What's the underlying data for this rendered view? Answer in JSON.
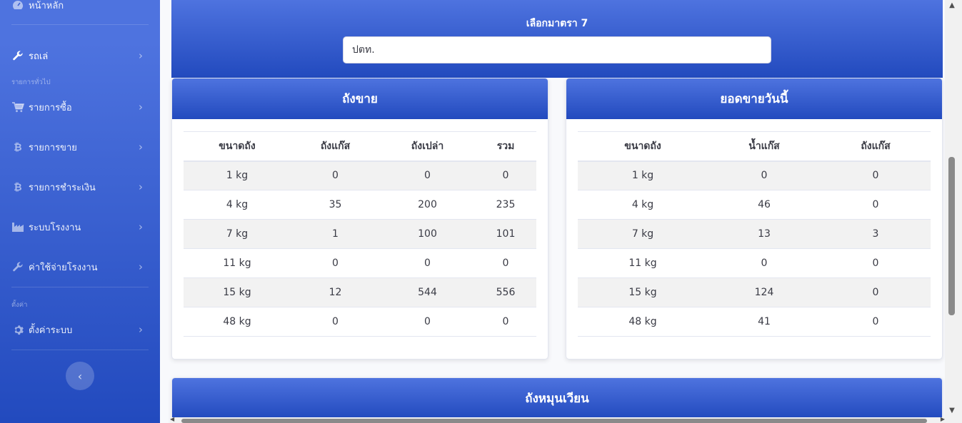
{
  "sidebar": {
    "dashboard": {
      "label": "หน้าหลัก",
      "icon": "gauge-icon"
    },
    "trucks": {
      "label": "รถเล่",
      "icon": "wrench-icon"
    },
    "heading_general": "รายการทั่วไป",
    "items": [
      {
        "label": "รายการซื้อ",
        "icon": "cart-icon"
      },
      {
        "label": "รายการขาย",
        "icon": "bitcoin-icon"
      },
      {
        "label": "รายการชำระเงิน",
        "icon": "bitcoin-icon"
      },
      {
        "label": "ระบบโรงงาน",
        "icon": "factory-icon"
      },
      {
        "label": "ค่าใช้จ่ายโรงงาน",
        "icon": "wrench-icon"
      }
    ],
    "heading_settings": "ตั้งค่า",
    "settings": {
      "label": "ตั้งค่าระบบ",
      "icon": "gear-icon"
    }
  },
  "banner": {
    "title": "เลือกมาตรา 7",
    "selected": "ปตท."
  },
  "stock_card": {
    "title": "ถังขาย",
    "headers": [
      "ขนาดถัง",
      "ถังแก๊ส",
      "ถังเปล่า",
      "รวม"
    ],
    "rows": [
      [
        "1 kg",
        "0",
        "0",
        "0"
      ],
      [
        "4 kg",
        "35",
        "200",
        "235"
      ],
      [
        "7 kg",
        "1",
        "100",
        "101"
      ],
      [
        "11 kg",
        "0",
        "0",
        "0"
      ],
      [
        "15 kg",
        "12",
        "544",
        "556"
      ],
      [
        "48 kg",
        "0",
        "0",
        "0"
      ]
    ]
  },
  "sales_card": {
    "title": "ยอดขายวันนี้",
    "headers": [
      "ขนาดถัง",
      "น้ำแก๊ส",
      "ถังแก๊ส"
    ],
    "rows": [
      [
        "1 kg",
        "0",
        "0"
      ],
      [
        "4 kg",
        "46",
        "0"
      ],
      [
        "7 kg",
        "13",
        "3"
      ],
      [
        "11 kg",
        "0",
        "0"
      ],
      [
        "15 kg",
        "124",
        "0"
      ],
      [
        "48 kg",
        "41",
        "0"
      ]
    ]
  },
  "circulation_card": {
    "title": "ถังหมุนเวียน"
  },
  "colors": {
    "primary": "#4e73df",
    "primary_dark": "#224abe"
  }
}
